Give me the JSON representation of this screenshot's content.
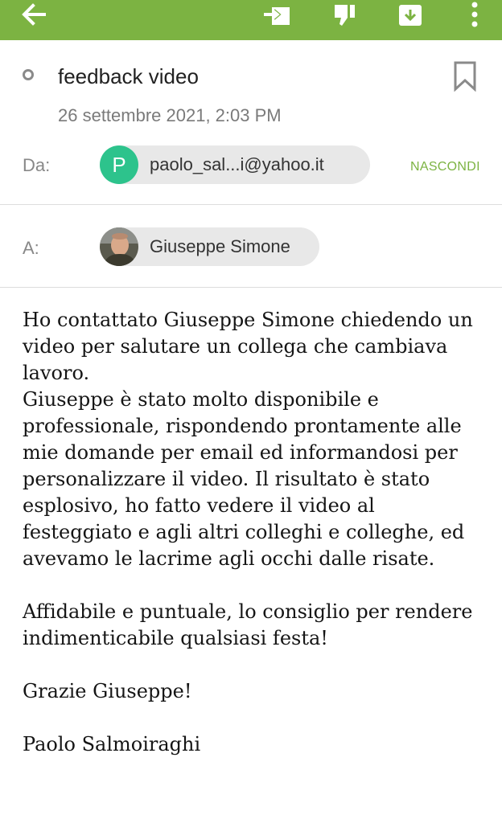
{
  "toolbar": {
    "background": "#7cb342",
    "icons": [
      "back-arrow-icon",
      "move-to-folder-icon",
      "thumbs-down-icon",
      "archive-icon",
      "more-options-icon"
    ]
  },
  "email": {
    "subject": "feedback video",
    "date": "26 settembre 2021, 2:03 PM",
    "from_label": "Da:",
    "from_initial": "P",
    "from_address": "paolo_sal...i@yahoo.it",
    "hide_label": "NASCONDI",
    "to_label": "A:",
    "to_name": "Giuseppe Simone"
  },
  "body": {
    "p1": "Ho contattato Giuseppe Simone chiedendo un video per salutare un collega che cambiava lavoro.",
    "p2": "Giuseppe è stato molto disponibile e professionale, rispondendo prontamente alle mie domande per email ed informandosi per personalizzare il video. Il risultato è stato esplosivo, ho fatto vedere il video al festeggiato e agli altri colleghi e colleghe, ed avevamo le lacrime agli occhi dalle risate.",
    "p3": "Affidabile e puntuale, lo consiglio per rendere indimenticabile qualsiasi festa!",
    "p4": "Grazie Giuseppe!",
    "p5": "Paolo Salmoiraghi"
  }
}
